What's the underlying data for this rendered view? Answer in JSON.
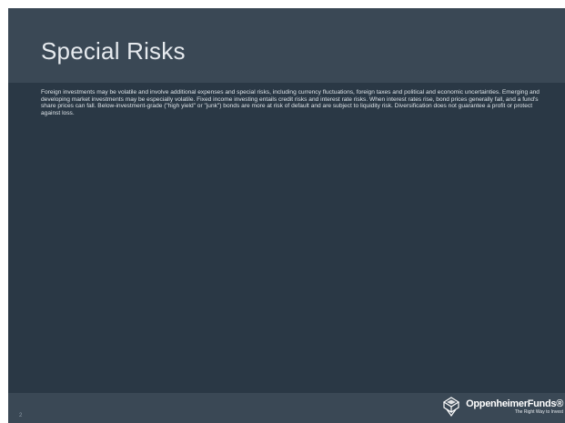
{
  "slide": {
    "title": "Special Risks",
    "body": "Foreign investments may be volatile and involve additional expenses and special risks, including currency fluctuations, foreign taxes and political and economic uncertainties. Emerging and developing market investments may be especially volatile. Fixed income investing entails credit risks and interest rate risks. When interest rates rise, bond prices generally fall, and a fund's share prices can fall. Below-investment-grade (\"high yield\" or \"junk\") bonds are more at risk of default and are subject to liquidity risk. Diversification does not guarantee a profit or protect against loss.",
    "page_number": "2"
  },
  "logo": {
    "name": "OppenheimerFunds®",
    "tagline": "The Right Way to Invest",
    "icon": "oppenheimer-logo-mark"
  },
  "colors": {
    "background": "#2a3845",
    "title_bar": "#3a4855",
    "footer_bar": "#3a4855",
    "text": "#dde3e8"
  }
}
